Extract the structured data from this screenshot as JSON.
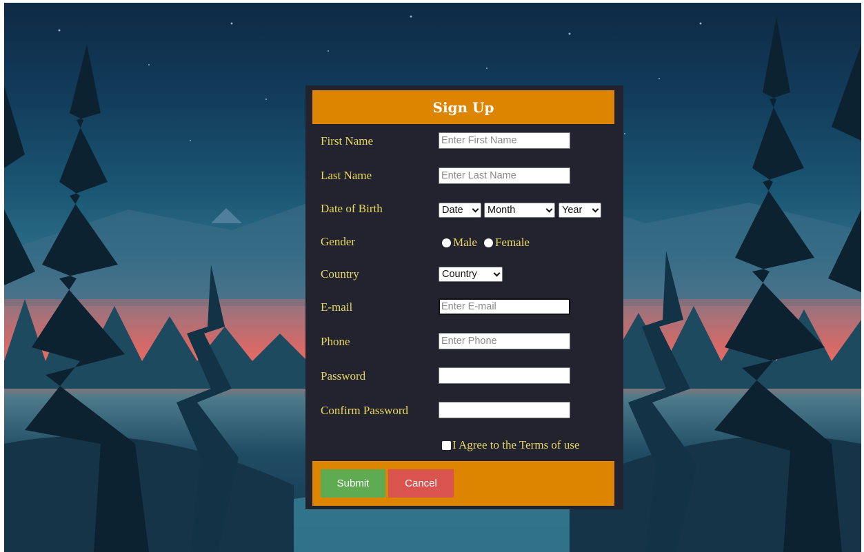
{
  "form": {
    "title": "Sign Up",
    "fields": {
      "first_name": {
        "label": "First Name",
        "placeholder": "Enter First Name",
        "value": ""
      },
      "last_name": {
        "label": "Last Name",
        "placeholder": "Enter Last Name",
        "value": ""
      },
      "dob": {
        "label": "Date of Birth",
        "date": "Date",
        "month": "Month",
        "year": "Year"
      },
      "gender": {
        "label": "Gender",
        "options": [
          "Male",
          "Female"
        ]
      },
      "country": {
        "label": "Country",
        "selected": "Country"
      },
      "email": {
        "label": "E-mail",
        "placeholder": "Enter E-mail",
        "value": ""
      },
      "phone": {
        "label": "Phone",
        "placeholder": "Enter Phone",
        "value": ""
      },
      "password": {
        "label": "Password",
        "value": ""
      },
      "confirm_password": {
        "label": "Confirm Password",
        "value": ""
      }
    },
    "terms_label": "I Agree to the Terms of use",
    "submit_label": "Submit",
    "cancel_label": "Cancel"
  },
  "colors": {
    "panel_bg": "#23222f",
    "accent": "#dd8500",
    "label_text": "#e6d95c",
    "submit": "#5eab52",
    "cancel": "#d9534f"
  },
  "icons": {
    "select_arrow": "chevron-down-icon",
    "radio": "radio-icon",
    "checkbox": "checkbox-icon"
  }
}
